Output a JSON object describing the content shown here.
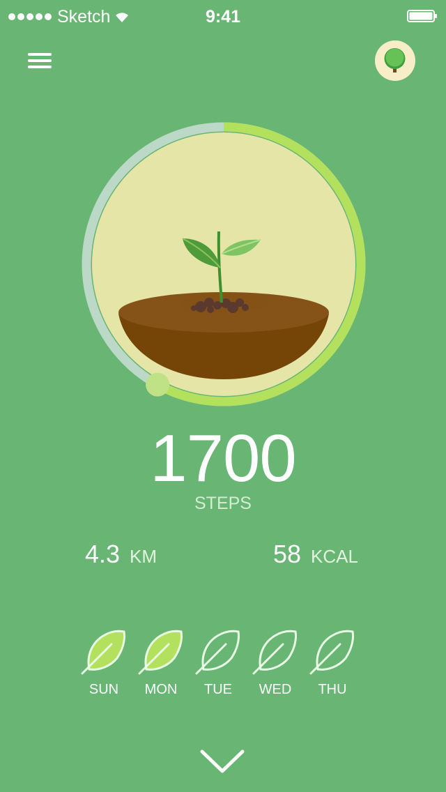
{
  "status_bar": {
    "carrier": "Sketch",
    "time": "9:41"
  },
  "header": {
    "menu_icon": "hamburger-menu-icon",
    "avatar_icon": "tree-icon"
  },
  "progress": {
    "fraction": 0.58
  },
  "steps": {
    "count": "1700",
    "label": "STEPS"
  },
  "metrics": [
    {
      "value": "4.3",
      "unit": "KM"
    },
    {
      "value": "58",
      "unit": "KCAL"
    }
  ],
  "week": [
    {
      "day": "SUN",
      "filled": true
    },
    {
      "day": "MON",
      "filled": true
    },
    {
      "day": "TUE",
      "filled": false
    },
    {
      "day": "WED",
      "filled": false
    },
    {
      "day": "THU",
      "filled": false
    }
  ],
  "colors": {
    "background": "#68b574",
    "ring_progress": "#b3e05d",
    "ring_track": "#bcd9c8",
    "ring_inner": "#e5e5a8",
    "leaf_filled": "#b3e05d",
    "leaf_outline": "#e8fbe4"
  },
  "footer": {
    "icon": "chevron-down-icon"
  }
}
